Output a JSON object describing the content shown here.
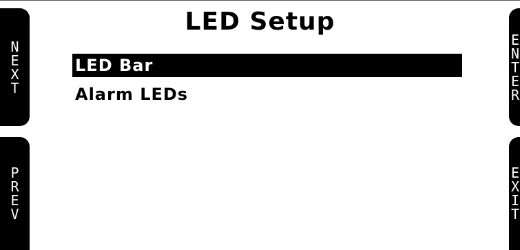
{
  "title": "LED Setup",
  "buttons": {
    "next": [
      "N",
      "E",
      "X",
      "T"
    ],
    "prev": [
      "P",
      "R",
      "E",
      "V"
    ],
    "enter": [
      "E",
      "N",
      "T",
      "E",
      "R"
    ],
    "exit": [
      "E",
      "X",
      "I",
      "T"
    ]
  },
  "menu": {
    "items": [
      {
        "label": "LED Bar",
        "selected": true
      },
      {
        "label": "Alarm LEDs",
        "selected": false
      }
    ]
  },
  "colors": {
    "background": "#ffffff",
    "foreground": "#000000",
    "highlight": "#000000"
  }
}
